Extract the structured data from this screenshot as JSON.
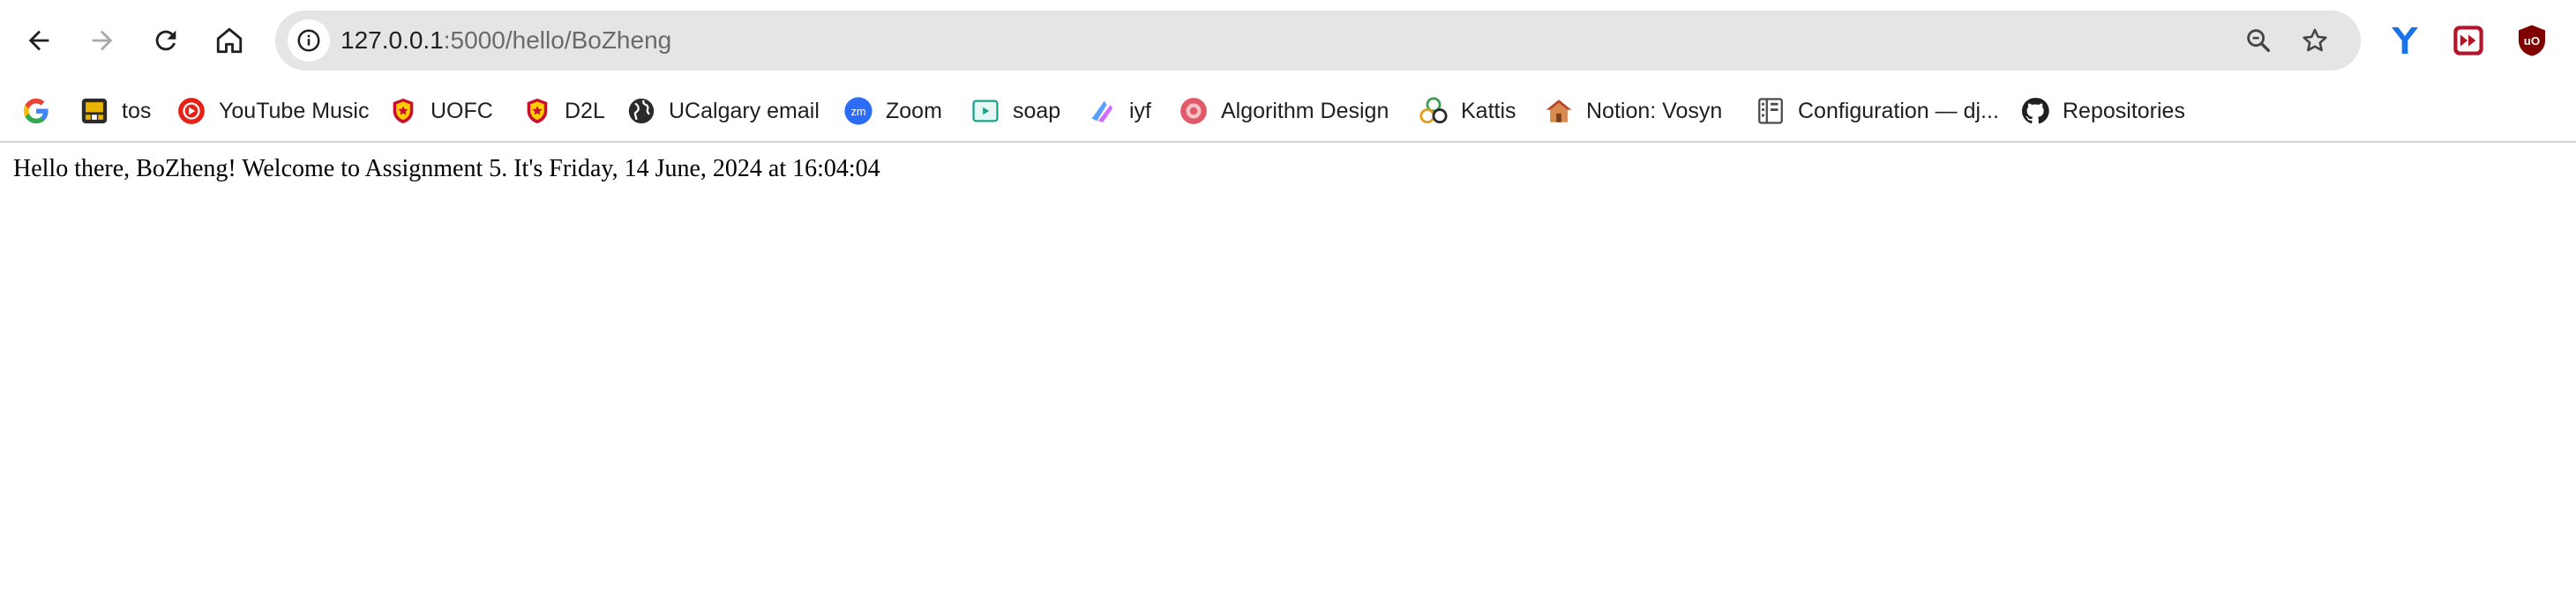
{
  "toolbar": {
    "url_host": "127.0.0.1",
    "url_path": ":5000/hello/BoZheng"
  },
  "bookmarks": [
    {
      "label": "",
      "icon": "google-icon"
    },
    {
      "label": "tos",
      "icon": "tos-icon"
    },
    {
      "label": "YouTube Music",
      "icon": "youtube-music-icon"
    },
    {
      "label": "UOFC",
      "icon": "ucalgary-shield-icon"
    },
    {
      "label": "D2L",
      "icon": "ucalgary-shield-icon"
    },
    {
      "label": "UCalgary email",
      "icon": "globe-icon"
    },
    {
      "label": "Zoom",
      "icon": "zoom-icon"
    },
    {
      "label": "soap",
      "icon": "soap-icon"
    },
    {
      "label": "iyf",
      "icon": "iyf-icon"
    },
    {
      "label": "Algorithm Design",
      "icon": "algorithm-design-icon"
    },
    {
      "label": "Kattis",
      "icon": "kattis-icon"
    },
    {
      "label": "Notion: Vosyn",
      "icon": "house-icon"
    },
    {
      "label": "Configuration — dj...",
      "icon": "django-doc-icon"
    },
    {
      "label": "Repositories",
      "icon": "github-icon"
    }
  ],
  "page": {
    "greeting": "Hello there, BoZheng! Welcome to Assignment 5. It's Friday, 14 June, 2024 at 16:04:04"
  },
  "colors": {
    "omnibox_bg": "#e5e5e5",
    "youtube_red": "#e62117",
    "ucalgary_red": "#c8102e",
    "ucalgary_gold": "#ffcd00",
    "zoom_blue": "#2d6cf5",
    "ext_blue": "#1a73e8",
    "ublock_red": "#800000"
  }
}
